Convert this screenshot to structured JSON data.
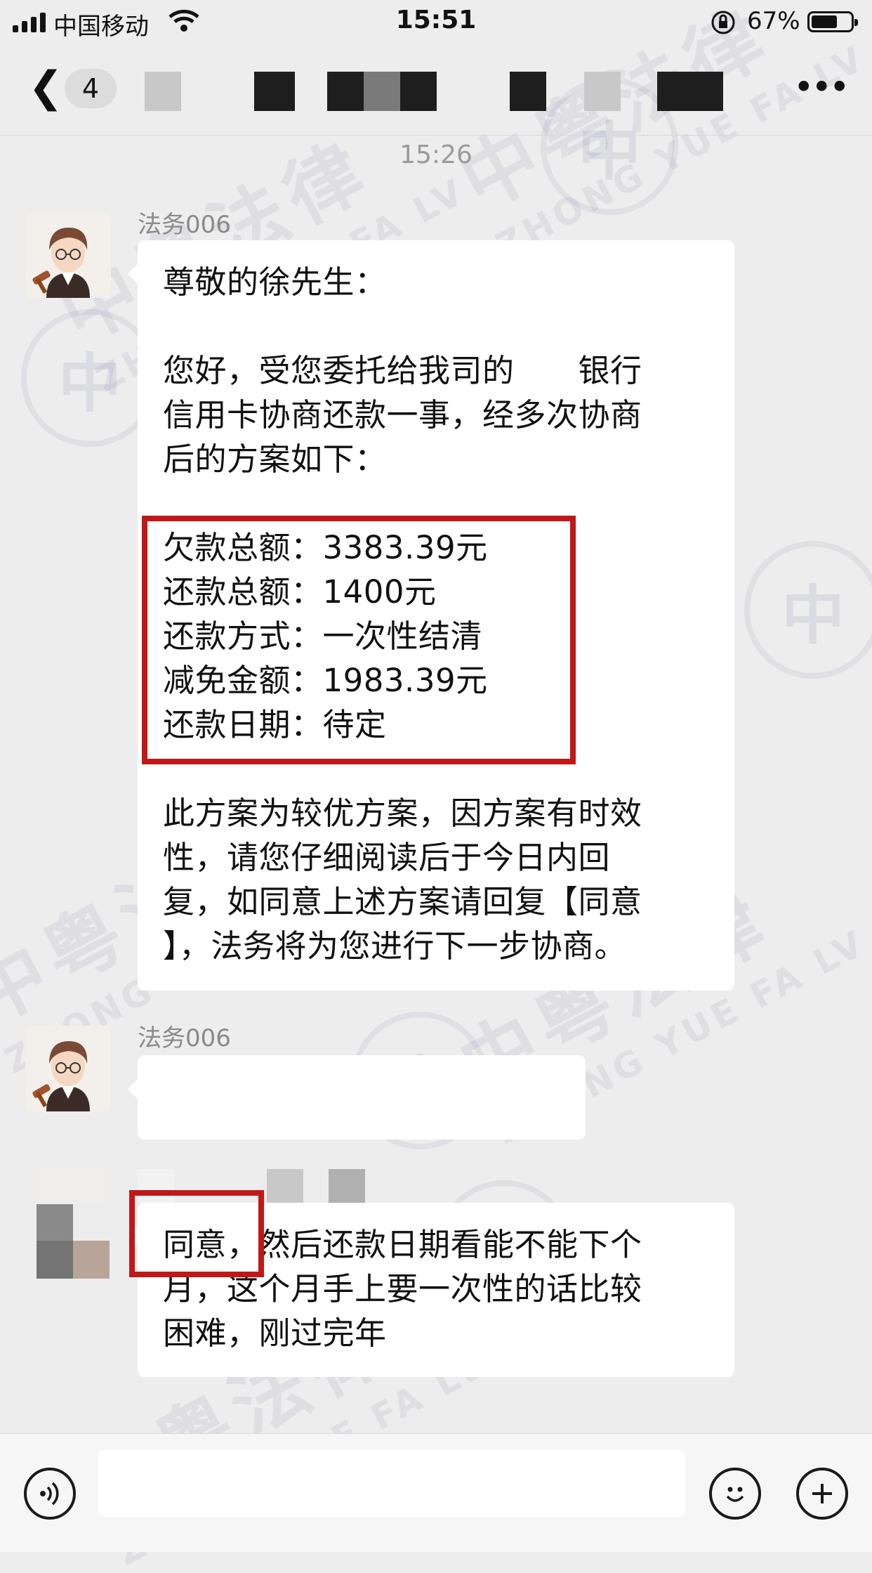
{
  "status_bar": {
    "carrier": "中国移动",
    "time": "15:51",
    "battery_percent_text": "67%",
    "battery_level": 0.67,
    "icons": [
      "signal-icon",
      "wifi-icon",
      "orientation-lock-icon",
      "battery-icon"
    ]
  },
  "nav": {
    "back_icon": "chevron-left-icon",
    "unread_count": "4",
    "more_icon": "more-icon"
  },
  "timestamp": "15:26",
  "messages": [
    {
      "sender": "法务006",
      "paragraphs": [
        [
          "尊敬的徐先生："
        ],
        [
          "您好，受您委托给我司的　　银行",
          "信用卡协商还款一事，经多次协商",
          "后的方案如下："
        ],
        [
          "欠款总额：3383.39元",
          "还款总额：1400元",
          "还款方式：一次性结清",
          "减免金额：1983.39元",
          "还款日期：待定"
        ],
        [
          "此方案为较优方案，因方案有时效",
          "性，请您仔细阅读后于今日内回",
          "复，如同意上述方案请回复【同意",
          "】，法务将为您进行下一步协商。"
        ]
      ]
    },
    {
      "sender": "法务006",
      "text": ""
    },
    {
      "sender": "",
      "lines": [
        "同意，然后还款日期看能不能下个",
        "月，这个月手上要一次性的话比较",
        "困难，刚过完年"
      ]
    }
  ],
  "watermark": {
    "cn": "中粤法律",
    "en": "ZHONG YUE FA LV",
    "seal_char": "中"
  },
  "input_bar": {
    "voice_icon": "voice-icon",
    "emoji_icon": "emoji-icon",
    "plus_icon": "plus-icon",
    "input_value": ""
  },
  "colors": {
    "background": "#ededed",
    "bubble": "#ffffff",
    "highlight_box": "#c01818"
  }
}
